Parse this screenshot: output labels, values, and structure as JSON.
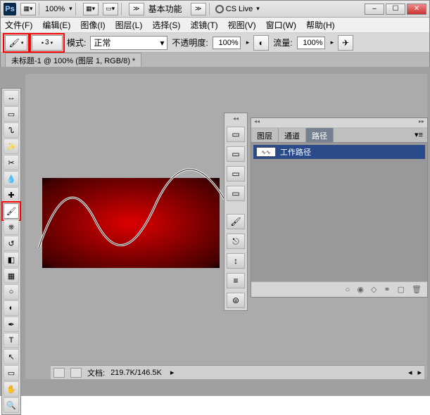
{
  "titlebar": {
    "app_icon": "Ps",
    "zoom": "100%",
    "workspace_label": "基本功能",
    "cslive": "CS Live"
  },
  "window_controls": {
    "min": "–",
    "max": "☐",
    "close": "✕"
  },
  "menus": {
    "file": "文件(F)",
    "edit": "编辑(E)",
    "image": "图像(I)",
    "layer": "图层(L)",
    "select": "选择(S)",
    "filter": "滤镜(T)",
    "view": "视图(V)",
    "window": "窗口(W)",
    "help": "帮助(H)"
  },
  "options_bar": {
    "brush_size": "3",
    "mode_label": "模式:",
    "mode_value": "正常",
    "opacity_label": "不透明度:",
    "opacity_value": "100%",
    "flow_label": "流量:",
    "flow_value": "100%"
  },
  "document": {
    "tab_title": "未标题-1 @ 100% (图层 1, RGB/8) *"
  },
  "panel": {
    "tabs": {
      "layers": "图层",
      "channels": "通道",
      "paths": "路径"
    },
    "active_tab": "paths",
    "path_name": "工作路径",
    "path_thumb": "∿∿"
  },
  "statusbar": {
    "doc_label": "文档:",
    "doc_value": "219.7K/146.5K"
  },
  "icons": {
    "brush": "🖌",
    "move": "↔",
    "marquee": "▭",
    "lasso": "ᔐ",
    "wand": "✨",
    "crop": "✂",
    "eyedrop": "💧",
    "heal": "✚",
    "stamp": "⎈",
    "history": "↺",
    "eraser": "◧",
    "gradient": "▦",
    "blur": "○",
    "dodge": "◐",
    "pen": "✒",
    "type": "T",
    "path_sel": "↖",
    "shape": "▭",
    "hand": "✋",
    "zoom_tool": "🔍",
    "doc": "▭",
    "trash": "🗑",
    "new": "▢",
    "chain": "⚭",
    "circle1": "○",
    "circle2": "◉",
    "circle3": "◇"
  }
}
